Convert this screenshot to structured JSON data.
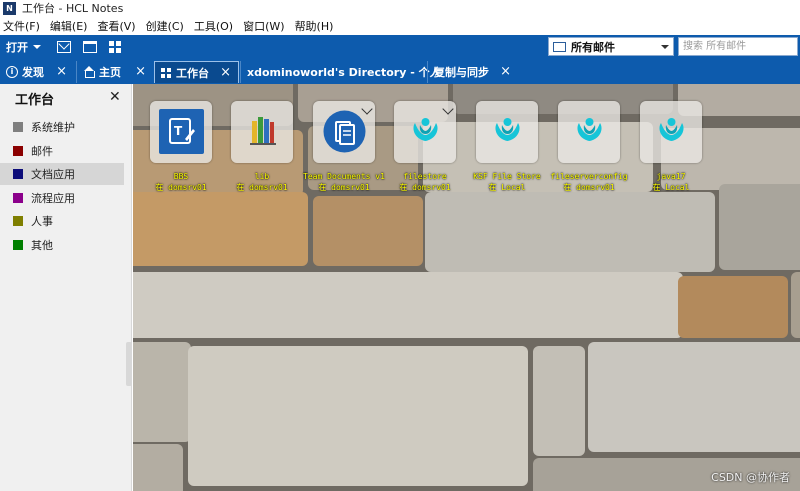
{
  "window": {
    "title": "工作台 - HCL Notes",
    "logo_text": "N"
  },
  "menubar": {
    "items": [
      "文件(F)",
      "编辑(E)",
      "查看(V)",
      "创建(C)",
      "工具(O)",
      "窗口(W)",
      "帮助(H)"
    ]
  },
  "toolbar": {
    "open_label": "打开",
    "mailbox_label": "所有邮件",
    "search_placeholder": "搜索 所有邮件"
  },
  "tabs": [
    {
      "label": "发现",
      "icon": "info-icon",
      "active": false
    },
    {
      "label": "主页",
      "icon": "home-icon",
      "active": false
    },
    {
      "label": "工作台",
      "icon": "workspace-icon",
      "active": true
    },
    {
      "label": "xdominoworld's Directory - 个人",
      "icon": "",
      "active": false
    },
    {
      "label": "复制与同步",
      "icon": "",
      "active": false
    }
  ],
  "sidebar": {
    "title": "工作台",
    "items": [
      {
        "label": "系统维护",
        "color": "#7f7f7f"
      },
      {
        "label": "邮件",
        "color": "#8b0000"
      },
      {
        "label": "文档应用",
        "color": "#0d0d7a"
      },
      {
        "label": "流程应用",
        "color": "#8b008b"
      },
      {
        "label": "人事",
        "color": "#7f7f00"
      },
      {
        "label": "其他",
        "color": "#007f00"
      }
    ],
    "selected_index": 2
  },
  "apps": [
    {
      "name": "BBS",
      "server": "在 domsrv01",
      "icon": "forum-icon",
      "has_dropdown": false
    },
    {
      "name": "lib",
      "server": "在 domsrv01",
      "icon": "library-books-icon",
      "has_dropdown": false
    },
    {
      "name": "Team Documents v1",
      "server": "在 domsrv01",
      "icon": "team-docs-icon",
      "has_dropdown": true
    },
    {
      "name": "filestore",
      "server": "在 domsrv01",
      "icon": "lotus-db-icon",
      "has_dropdown": true
    },
    {
      "name": "KSF File Store",
      "server": "在 Local",
      "icon": "lotus-db-icon",
      "has_dropdown": false
    },
    {
      "name": "fileserverconfig",
      "server": "在 domsrv01",
      "icon": "lotus-db-icon",
      "has_dropdown": false
    },
    {
      "name": "java17",
      "server": "在 Local",
      "icon": "lotus-db-icon",
      "has_dropdown": false
    }
  ],
  "watermark": "CSDN @协作者",
  "colors": {
    "accent": "#0d5bad",
    "label_yellow": "#ffff00"
  }
}
